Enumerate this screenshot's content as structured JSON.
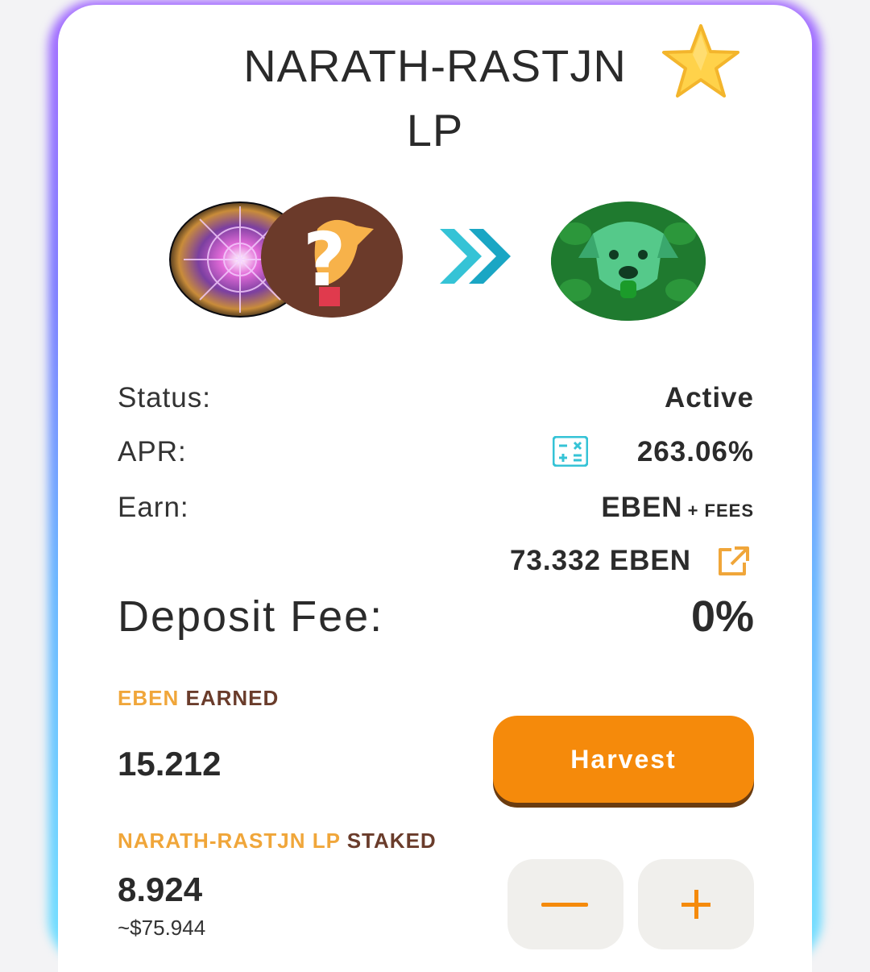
{
  "pool": {
    "title_line1": "NARATH-RASTJN",
    "title_line2": "LP"
  },
  "icons": {
    "favorite": "star-icon",
    "apr_calc": "calculator-icon",
    "external": "external-link-icon",
    "route": "double-chevron-right-icon"
  },
  "details": {
    "status_label": "Status:",
    "status_value": "Active",
    "apr_label": "APR:",
    "apr_value": "263.06%",
    "earn_label": "Earn:",
    "earn_token": "EBEN",
    "earn_fees": "+ FEES",
    "earn_amount": "73.332 EBEN",
    "deposit_fee_label": "Deposit Fee:",
    "deposit_fee_value": "0%"
  },
  "earned": {
    "token": "EBEN",
    "label": "EARNED",
    "amount": "15.212",
    "harvest_label": "Harvest"
  },
  "staked": {
    "token": "NARATH-RASTJN LP",
    "label": "STAKED",
    "amount": "8.924",
    "usd": "~$75.944"
  },
  "colors": {
    "accent": "#f58a0b",
    "highlight": "#f0a63a",
    "dark_brown": "#6a3c2b",
    "teal": "#35c3d6"
  }
}
